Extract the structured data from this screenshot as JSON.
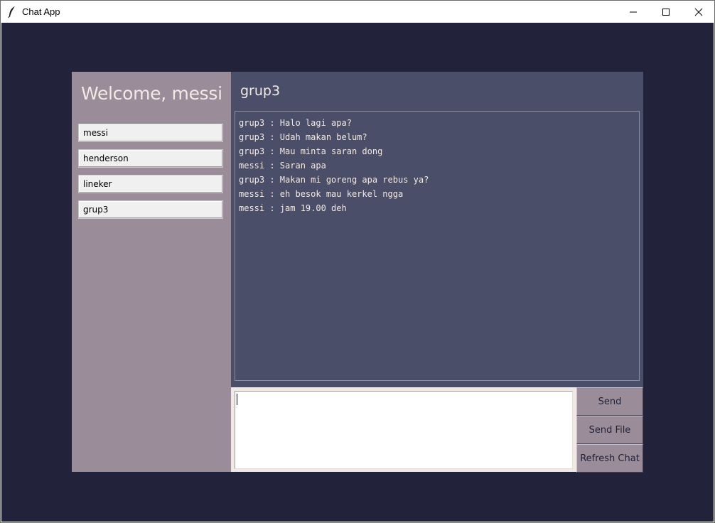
{
  "window": {
    "title": "Chat App",
    "icon": "feather-icon",
    "controls": [
      "minimize-icon",
      "maximize-icon",
      "close-icon"
    ]
  },
  "sidebar": {
    "welcome": "Welcome, messi",
    "users": [
      {
        "label": "messi"
      },
      {
        "label": "henderson"
      },
      {
        "label": "lineker"
      },
      {
        "label": "grup3"
      }
    ]
  },
  "chat": {
    "title": "grup3",
    "messages": [
      "grup3 : Halo lagi apa?",
      "grup3 : Udah makan belum?",
      "grup3 : Mau minta saran dong",
      "messi : Saran apa",
      "grup3 : Makan mi goreng apa rebus ya?",
      "messi : eh besok mau kerkel ngga",
      "messi : jam 19.00 deh"
    ]
  },
  "composer": {
    "value": ""
  },
  "actions": {
    "send": "Send",
    "send_file": "Send File",
    "refresh": "Refresh Chat"
  },
  "colors": {
    "background": "#22223b",
    "panel": "#4a4e69",
    "sidebar": "#9a8c98",
    "text_light": "#f2e9e4"
  }
}
